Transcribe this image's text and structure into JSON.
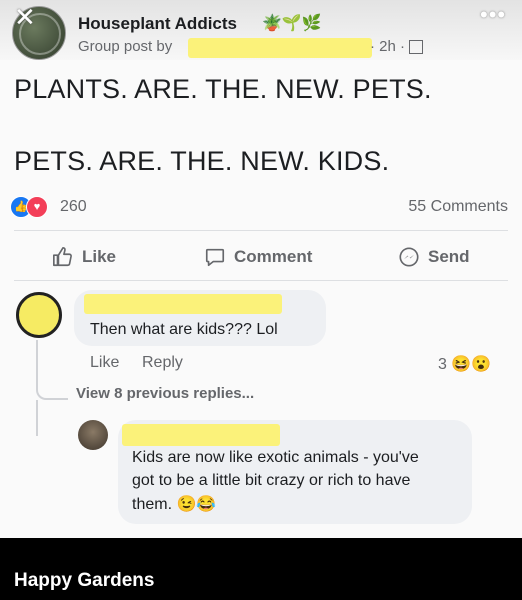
{
  "post": {
    "close_glyph": "✕",
    "group_name": "Houseplant Addicts",
    "group_emojis": "🪴🌱🌿",
    "meta_prefix": "Group post by",
    "meta_suffix": "· 2h · ",
    "more_glyph": "•••",
    "caption_line1": "PLANTS. ARE. THE. NEW. PETS.",
    "caption_line2": "PETS. ARE. THE. NEW. KIDS.",
    "reaction_count": "260",
    "comments_count": "55 Comments"
  },
  "actions": {
    "like": "Like",
    "comment": "Comment",
    "send": "Send"
  },
  "comment1": {
    "text": "Then what are kids??? Lol",
    "like": "Like",
    "reply": "Reply",
    "reaction_count": "3",
    "reaction_emojis": "😆😮"
  },
  "thread": {
    "view_previous": "View 8 previous replies..."
  },
  "reply1": {
    "line1": "Kids are now like exotic animals - you've",
    "line2": "got to be a little bit crazy or rich to have",
    "line3": "them.",
    "emojis": "😉😂"
  },
  "footer": {
    "text": "Happy Gardens"
  },
  "colors": {
    "redaction": "#fbf27a",
    "link_blue": "#1877f2",
    "love_red": "#f33e58"
  }
}
